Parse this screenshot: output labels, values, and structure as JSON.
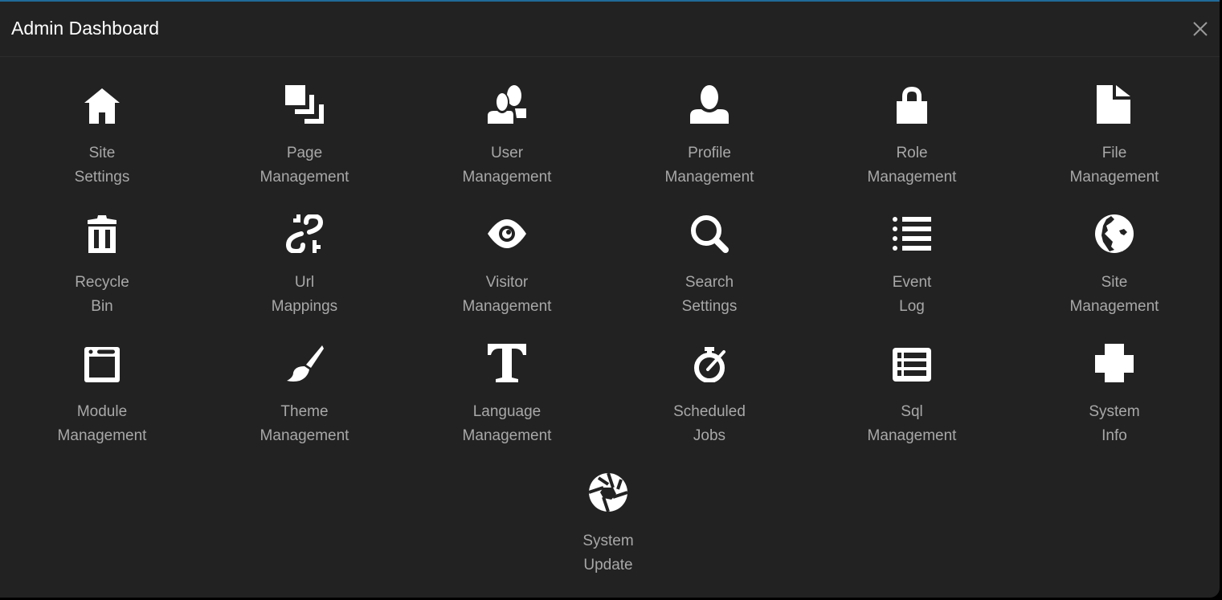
{
  "header": {
    "title": "Admin Dashboard",
    "close_icon": "close-icon"
  },
  "colors": {
    "background": "#222222",
    "accent_border": "#1f6a99",
    "icon": "#ffffff",
    "label": "#a8a8a8"
  },
  "items": [
    {
      "line1": "Site",
      "line2": "Settings",
      "icon": "home-icon"
    },
    {
      "line1": "Page",
      "line2": "Management",
      "icon": "pages-icon"
    },
    {
      "line1": "User",
      "line2": "Management",
      "icon": "people-icon"
    },
    {
      "line1": "Profile",
      "line2": "Management",
      "icon": "person-icon"
    },
    {
      "line1": "Role",
      "line2": "Management",
      "icon": "lock-icon"
    },
    {
      "line1": "File",
      "line2": "Management",
      "icon": "file-icon"
    },
    {
      "line1": "Recycle",
      "line2": "Bin",
      "icon": "trash-icon"
    },
    {
      "line1": "Url",
      "line2": "Mappings",
      "icon": "broken-link-icon"
    },
    {
      "line1": "Visitor",
      "line2": "Management",
      "icon": "eye-icon"
    },
    {
      "line1": "Search",
      "line2": "Settings",
      "icon": "magnifier-icon"
    },
    {
      "line1": "Event",
      "line2": "Log",
      "icon": "list-icon"
    },
    {
      "line1": "Site",
      "line2": "Management",
      "icon": "globe-icon"
    },
    {
      "line1": "Module",
      "line2": "Management",
      "icon": "browser-window-icon"
    },
    {
      "line1": "Theme",
      "line2": "Management",
      "icon": "brush-icon"
    },
    {
      "line1": "Language",
      "line2": "Management",
      "icon": "text-icon"
    },
    {
      "line1": "Scheduled",
      "line2": "Jobs",
      "icon": "timer-icon"
    },
    {
      "line1": "Sql",
      "line2": "Management",
      "icon": "table-list-icon"
    },
    {
      "line1": "System",
      "line2": "Info",
      "icon": "medical-cross-icon"
    },
    {
      "line1": "System",
      "line2": "Update",
      "icon": "aperture-icon"
    }
  ]
}
